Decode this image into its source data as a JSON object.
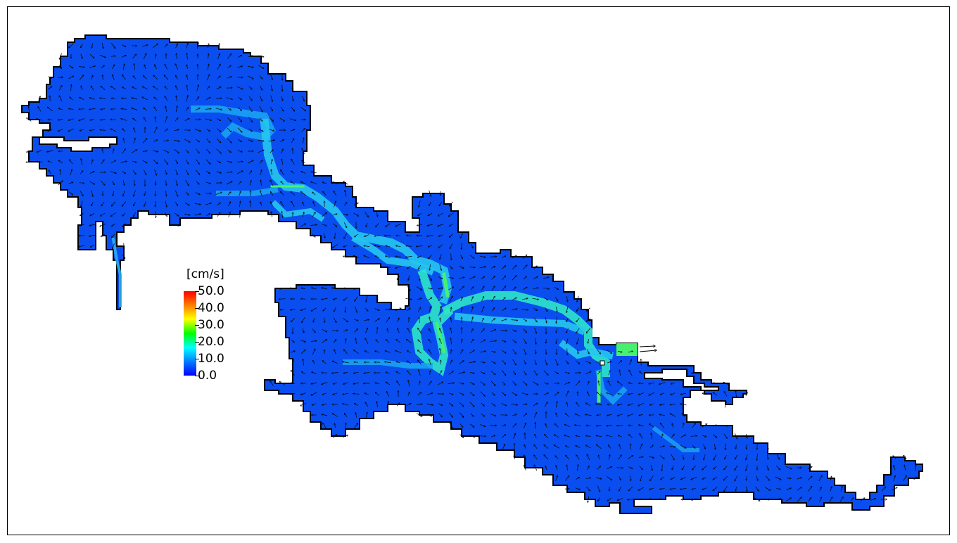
{
  "legend": {
    "unit": "[cm/s]",
    "ticks": [
      "50.0",
      "40.0",
      "30.0",
      "20.0",
      "10.0",
      "0.0"
    ],
    "colors": [
      "#ff0000",
      "#ff8000",
      "#ffff00",
      "#00ff00",
      "#00ffff",
      "#0080ff",
      "#0000ff"
    ]
  },
  "map": {
    "water_color": "#0a4ef0",
    "land_color": "#ffffff",
    "outline_color": "#000000",
    "fast_flow_colors": [
      "#18b4ee",
      "#2ee6c8",
      "#48f070"
    ]
  }
}
